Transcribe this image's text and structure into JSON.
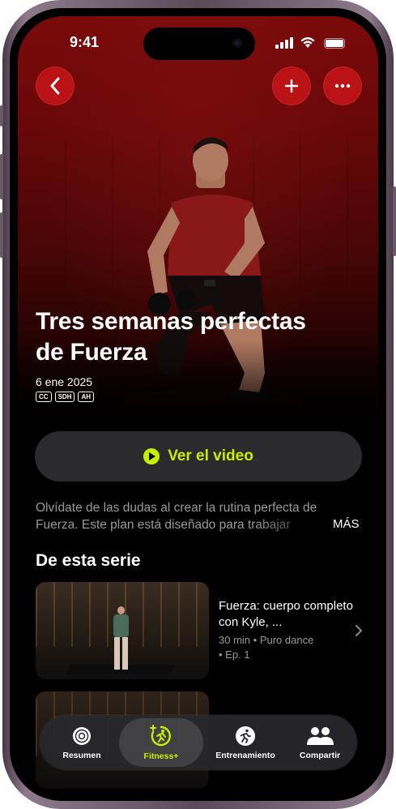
{
  "status_bar": {
    "time": "9:41"
  },
  "hero": {
    "title_line1": "Tres semanas perfectas",
    "title_line2": "de Fuerza",
    "date": "6 ene 2025",
    "badges": [
      "CC",
      "SDH",
      "AH"
    ]
  },
  "buttons": {
    "back_icon": "chevron-left-icon",
    "add_icon": "plus-icon",
    "more_icon": "ellipsis-icon",
    "play_label": "Ver el video"
  },
  "description": {
    "line1": "Olvídate de las dudas al crear la rutina perfecta de",
    "line2": "Fuerza. Este plan está diseñado para trabajar",
    "more_label": "MÁS"
  },
  "series": {
    "heading": "De esta serie",
    "episodes": [
      {
        "title": "Fuerza: cuerpo completo con Kyle, ...",
        "duration": "30 min",
        "music": "Puro dance",
        "episode": "Ep. 1"
      }
    ]
  },
  "tabbar": {
    "tabs": [
      {
        "label": "Resumen",
        "icon": "activity-rings-icon"
      },
      {
        "label": "Fitness+",
        "icon": "fitness-plus-icon",
        "active": true
      },
      {
        "label": "Entrenamiento",
        "icon": "running-figure-icon"
      },
      {
        "label": "Compartir",
        "icon": "people-icon"
      }
    ]
  },
  "colors": {
    "accent": "#c5f000",
    "hero_red": "#7a0a0a",
    "button_red": "#c81419",
    "background": "#000000"
  }
}
